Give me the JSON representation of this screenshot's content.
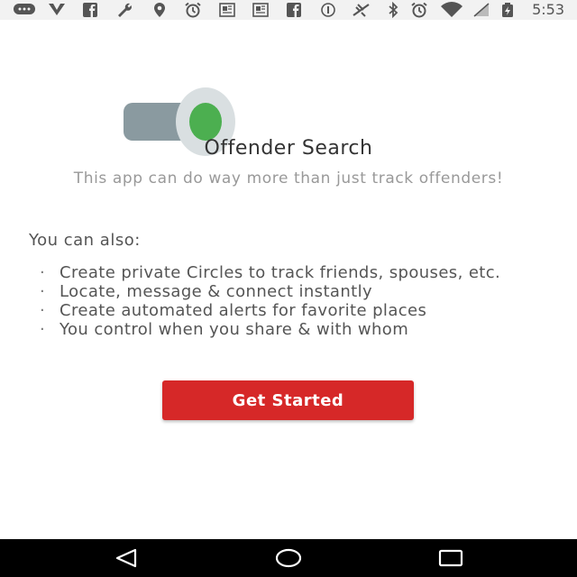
{
  "status_bar": {
    "time": "5:53",
    "left_icons": [
      "messages-icon",
      "v-icon",
      "facebook-icon",
      "wrench-icon",
      "location-icon",
      "alarm-icon",
      "news-icon",
      "news-icon",
      "facebook-icon",
      "info-icon"
    ],
    "right_icons": [
      "no-signal-icon",
      "bluetooth-icon",
      "alarm-icon",
      "wifi-icon",
      "cell-signal-icon",
      "battery-charging-icon"
    ]
  },
  "app": {
    "title": "Offender Search",
    "subtitle": "This app can do way more than just track offenders!",
    "intro": "You can also:",
    "features": [
      "Create private Circles to track friends, spouses, etc.",
      "Locate, message & connect instantly",
      "Create automated alerts for favorite places",
      "You control when you share & with whom"
    ],
    "bullet": "·",
    "cta_label": "Get Started",
    "colors": {
      "accent": "#d62828",
      "logo_green": "#4caf50",
      "logo_gray": "#8a9aa0"
    }
  },
  "nav_bar": {
    "buttons": [
      "back-icon",
      "home-icon",
      "recents-icon"
    ]
  }
}
